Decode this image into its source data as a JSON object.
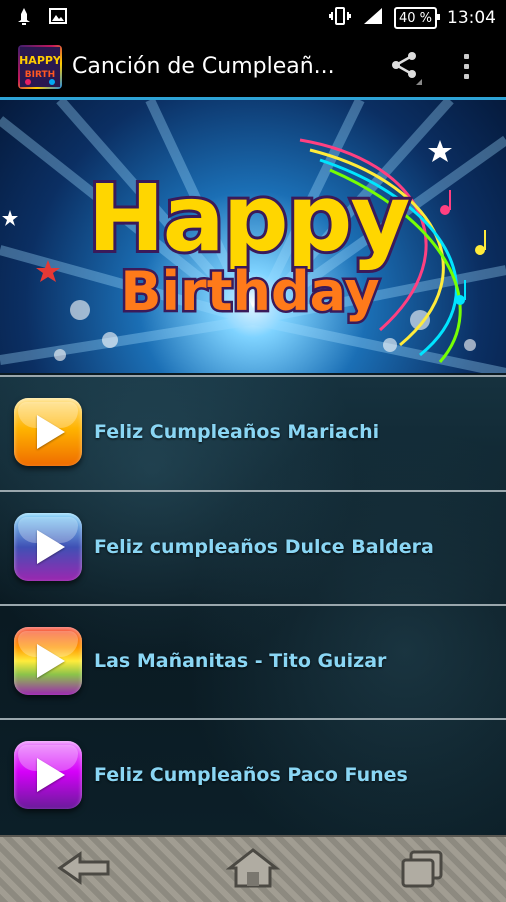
{
  "status_bar": {
    "battery_percent": "40 %",
    "time": "13:04"
  },
  "action_bar": {
    "title": "Canción de Cumpleañ..."
  },
  "banner": {
    "line1": "Happy",
    "line2": "Birthday"
  },
  "songs": [
    {
      "label": "Feliz Cumpleaños Mariachi",
      "color_top": "#ffd54f",
      "color_bottom": "#f57c00"
    },
    {
      "label": "Feliz cumpleaños Dulce Baldera",
      "color_top": "#4fc3f7",
      "color_bottom": "#8e24aa"
    },
    {
      "label": "Las Mañanitas - Tito Guizar",
      "color_top": "#f44336",
      "color_bottom": "#7cb342"
    },
    {
      "label": "Feliz Cumpleaños Paco Funes",
      "color_top": "#e040fb",
      "color_bottom": "#6a1b9a"
    }
  ],
  "colors": {
    "accent": "#2ea3d6",
    "song_text": "#8ad6f4"
  }
}
